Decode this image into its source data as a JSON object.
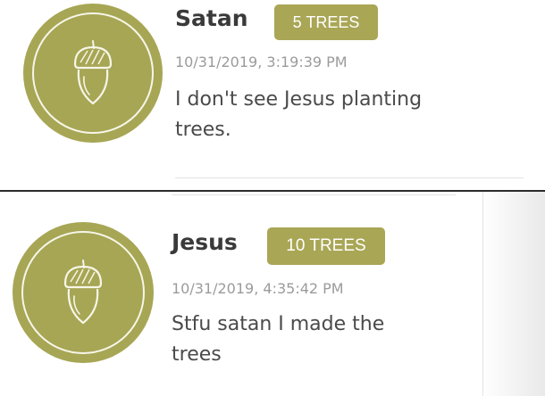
{
  "comments": [
    {
      "author": "Satan",
      "badge": "5 TREES",
      "timestamp": "10/31/2019, 3:19:39 PM",
      "message_lines": [
        "I don't see Jesus planting",
        "trees."
      ],
      "avatar_icon": "acorn-icon"
    },
    {
      "author": "Jesus",
      "badge": "10 TREES",
      "timestamp": "10/31/2019, 4:35:42 PM",
      "message_lines": [
        "Stfu satan I made the",
        "trees"
      ],
      "avatar_icon": "acorn-icon"
    }
  ],
  "colors": {
    "accent": "#a7a655",
    "badge_text": "#ffffff",
    "name_text": "#3a3a3a",
    "timestamp_text": "#9b9b9b",
    "message_text": "#4a4a4a"
  }
}
